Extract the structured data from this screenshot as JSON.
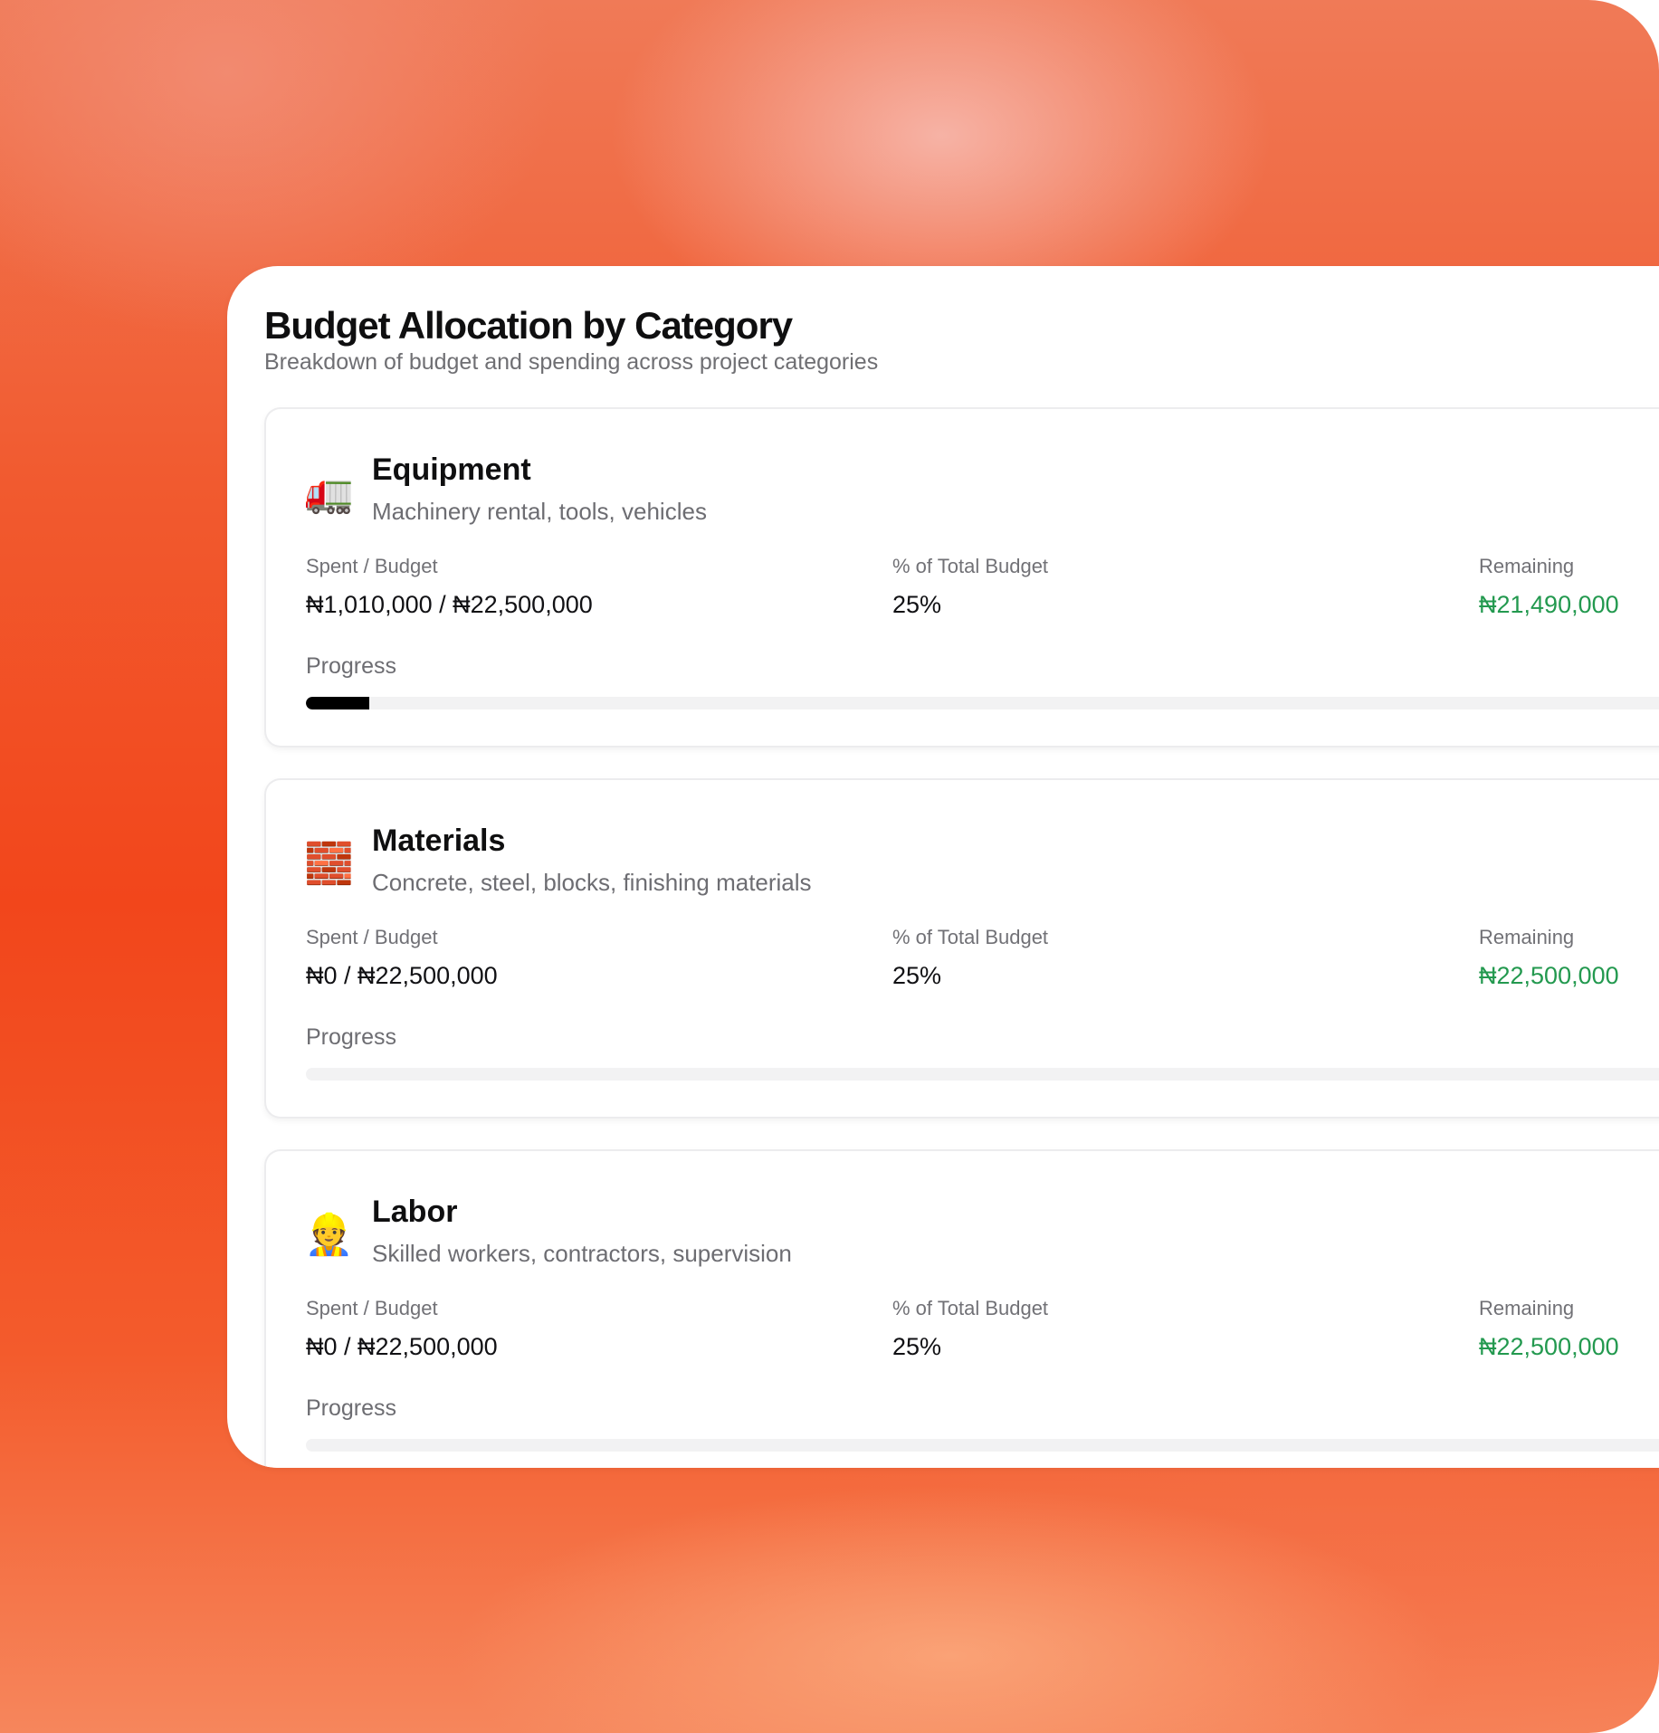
{
  "panel": {
    "title": "Budget Allocation by Category",
    "subtitle": "Breakdown of budget and spending across project categories"
  },
  "labels": {
    "spent_budget": "Spent / Budget",
    "percent_total": "% of Total Budget",
    "remaining": "Remaining",
    "progress": "Progress"
  },
  "colors": {
    "remaining_text": "#23994f",
    "progress_fill": "#000000",
    "progress_track": "#f2f2f3"
  },
  "categories": [
    {
      "name": "Equipment",
      "description": "Machinery rental, tools, vehicles",
      "icon": "🚛",
      "icon_name": "truck-icon",
      "spent_budget": "₦1,010,000 / ₦22,500,000",
      "percent_of_total": "25%",
      "remaining": "₦21,490,000",
      "progress_fraction": 0.0449
    },
    {
      "name": "Materials",
      "description": "Concrete, steel, blocks, finishing materials",
      "icon": "🧱",
      "icon_name": "bricks-icon",
      "spent_budget": "₦0 / ₦22,500,000",
      "percent_of_total": "25%",
      "remaining": "₦22,500,000",
      "progress_fraction": 0
    },
    {
      "name": "Labor",
      "description": "Skilled workers, contractors, supervision",
      "icon": "👷",
      "icon_name": "construction-worker-icon",
      "spent_budget": "₦0 / ₦22,500,000",
      "percent_of_total": "25%",
      "remaining": "₦22,500,000",
      "progress_fraction": 0
    }
  ]
}
